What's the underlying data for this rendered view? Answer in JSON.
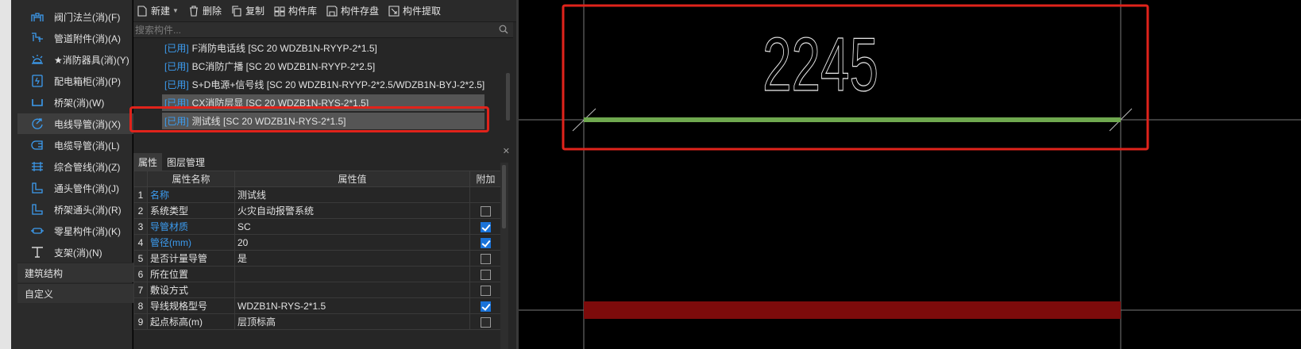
{
  "sidebar": {
    "items": [
      {
        "label": "阀门法兰(消)(F)",
        "icon": "valve-flange-icon"
      },
      {
        "label": "管道附件(消)(A)",
        "icon": "pipe-fitting-icon"
      },
      {
        "label": "★消防器具(消)(Y)",
        "icon": "alarm-bell-icon"
      },
      {
        "label": "配电箱柜(消)(P)",
        "icon": "distribution-box-icon"
      },
      {
        "label": "桥架(消)(W)",
        "icon": "cable-tray-icon"
      },
      {
        "label": "电线导管(消)(X)",
        "icon": "wire-conduit-icon",
        "selected": true
      },
      {
        "label": "电缆导管(消)(L)",
        "icon": "cable-conduit-icon"
      },
      {
        "label": "综合管线(消)(Z)",
        "icon": "combined-pipeline-icon"
      },
      {
        "label": "通头管件(消)(J)",
        "icon": "tee-fitting-icon"
      },
      {
        "label": "桥架通头(消)(R)",
        "icon": "tray-tee-icon"
      },
      {
        "label": "零星构件(消)(K)",
        "icon": "misc-component-icon"
      },
      {
        "label": "支架(消)(N)",
        "icon": "support-icon"
      }
    ],
    "groups": [
      "建筑结构",
      "自定义"
    ]
  },
  "toolbar": {
    "new": "新建",
    "delete": "删除",
    "copy": "复制",
    "library": "构件库",
    "save": "构件存盘",
    "extract": "构件提取"
  },
  "search": {
    "placeholder": "搜索构件..."
  },
  "components": {
    "tag": "[已用]",
    "rows": [
      "F消防电话线 [SC 20 WDZB1N-RYYP-2*1.5]",
      "BC消防广播 [SC 20 WDZB1N-RYYP-2*2.5]",
      "S+D电源+信号线 [SC 20 WDZB1N-RYYP-2*2.5/WDZB1N-BYJ-2*2.5]",
      "CX消防层显 [SC 20 WDZB1N-RYS-2*1.5]",
      "测试线 [SC 20 WDZB1N-RYS-2*1.5]"
    ]
  },
  "properties": {
    "tabs": [
      "属性",
      "图层管理"
    ],
    "headers": {
      "name": "属性名称",
      "value": "属性值",
      "extra": "附加"
    },
    "rows": [
      {
        "num": "1",
        "name": "名称",
        "value": "测试线",
        "blue": true,
        "checkbox": "none"
      },
      {
        "num": "2",
        "name": "系统类型",
        "value": "火灾自动报警系统",
        "blue": false,
        "checkbox": "off"
      },
      {
        "num": "3",
        "name": "导管材质",
        "value": "SC",
        "blue": true,
        "checkbox": "on"
      },
      {
        "num": "4",
        "name": "管径(mm)",
        "value": "20",
        "blue": true,
        "checkbox": "on"
      },
      {
        "num": "5",
        "name": "是否计量导管",
        "value": "是",
        "blue": false,
        "checkbox": "off"
      },
      {
        "num": "6",
        "name": "所在位置",
        "value": "",
        "blue": false,
        "checkbox": "off"
      },
      {
        "num": "7",
        "name": "敷设方式",
        "value": "",
        "blue": false,
        "checkbox": "off"
      },
      {
        "num": "8",
        "name": "导线规格型号",
        "value": "WDZB1N-RYS-2*1.5",
        "blue": false,
        "checkbox": "on"
      },
      {
        "num": "9",
        "name": "起点标高(m)",
        "value": "层顶标高",
        "blue": false,
        "checkbox": "off"
      }
    ]
  },
  "canvas": {
    "dimension_text": "2245",
    "colors": {
      "dimension_line": "#6fa84f",
      "annotation_box": "#e0231b",
      "conduit_fill": "#7d0b0b",
      "grid": "#7a7a7a"
    }
  }
}
